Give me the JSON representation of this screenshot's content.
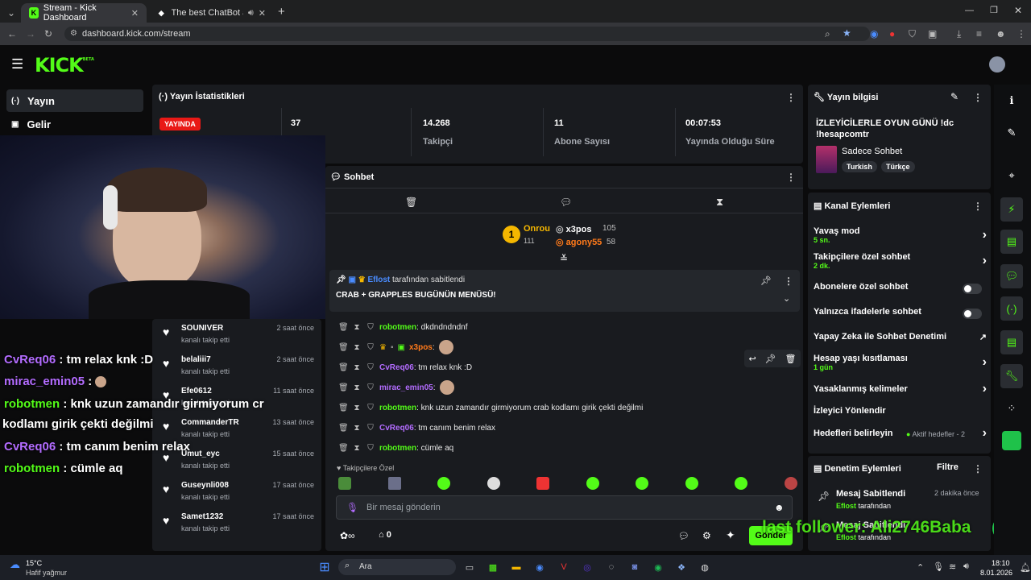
{
  "browser": {
    "tabs": [
      {
        "title": "Stream - Kick Dashboard",
        "icon": "kick-icon"
      },
      {
        "title": "The best ChatBot and Widg",
        "icon": "chatbot-icon"
      }
    ],
    "url": "dashboard.kick.com/stream"
  },
  "brand": {
    "logo": "KICK",
    "beta": "BETA",
    "accent": "#53fc18"
  },
  "sidebar": {
    "items": [
      {
        "label": "Yayın",
        "icon": "broadcast-icon"
      },
      {
        "label": "Gelir",
        "icon": "revenue-icon"
      }
    ]
  },
  "stats": {
    "title": "Yayın İstatistikleri",
    "live_badge": "YAYINDA",
    "viewers": "37",
    "followers": {
      "value": "14.268",
      "label": "Takipçi"
    },
    "subs": {
      "value": "11",
      "label": "Abone Sayısı"
    },
    "duration": {
      "value": "00:07:53",
      "label": "Yayında Olduğu Süre"
    }
  },
  "overlay_chat": [
    {
      "user": "CvReq06",
      "text": " : tm relax knk :D",
      "color": "#b36cff"
    },
    {
      "user": "mirac_emin05",
      "text": " :",
      "color": "#b36cff"
    },
    {
      "user": "robotmen",
      "text": " : knk uzun zamandır girmiyorum cr",
      "color": "#53fc18"
    },
    {
      "user": "",
      "text": "kodlamı girik çekti değilmi",
      "color": "#fff"
    },
    {
      "user": "CvReq06",
      "text": " : tm canım benim relax",
      "color": "#b36cff"
    },
    {
      "user": "robotmen",
      "text": " : cümle aq",
      "color": "#53fc18"
    }
  ],
  "followers_list": [
    {
      "name": "SOUNIVER",
      "sub": "kanalı takip etti",
      "time": "2 saat önce"
    },
    {
      "name": "belaliii7",
      "sub": "kanalı takip etti",
      "time": "2 saat önce"
    },
    {
      "name": "Efe0612",
      "sub": "kanalı takip etti",
      "time": "11 saat önce"
    },
    {
      "name": "CommanderTR",
      "sub": "kanalı takip etti",
      "time": "13 saat önce"
    },
    {
      "name": "Umut_eyc",
      "sub": "kanalı takip etti",
      "time": "15 saat önce"
    },
    {
      "name": "Guseynli008",
      "sub": "kanalı takip etti",
      "time": "17 saat önce"
    },
    {
      "name": "Samet1232",
      "sub": "kanalı takip etti",
      "time": "17 saat önce"
    }
  ],
  "chat": {
    "title": "Sohbet",
    "leaderboard": {
      "top": {
        "name": "Onrou",
        "count": "111"
      },
      "second": {
        "name": "x3pos",
        "count": "105"
      },
      "third": {
        "name": "agony55",
        "count": "58"
      },
      "rank": "1"
    },
    "pinned": {
      "by_user": "Eflost",
      "by_text": "tarafından sabitlendi",
      "message": "CRAB + GRAPPLES BUGÜNÜN MENÜSÜ!"
    },
    "messages": [
      {
        "user": "robotmen",
        "text": "dkdndndndnf",
        "color": "#53fc18"
      },
      {
        "user": "x3pos",
        "text": "",
        "color": "#ff7a1a"
      },
      {
        "user": "CvReq06",
        "text": "tm relax knk :D",
        "color": "#b36cff"
      },
      {
        "user": "mirac_emin05",
        "text": "",
        "color": "#b36cff"
      },
      {
        "user": "robotmen",
        "text": "knk uzun zamandır girmiyorum crab kodlamı girik çekti değilmi",
        "color": "#53fc18"
      },
      {
        "user": "CvReq06",
        "text": "tm canım benim relax",
        "color": "#b36cff"
      },
      {
        "user": "robotmen",
        "text": "cümle aq",
        "color": "#53fc18"
      }
    ],
    "followers_only": "Takipçilere Özel",
    "input_placeholder": "Bir mesaj gönderin",
    "points": "0",
    "send": "Gönder"
  },
  "stream_info": {
    "title": "Yayın bilgisi",
    "stream_title": "İZLEYİCİLERLE OYUN GÜNÜ !dc !hesapcomtr",
    "category": "Sadece Sohbet",
    "tags": [
      "Turkish",
      "Türkçe"
    ]
  },
  "channel_actions": {
    "title": "Kanal Eylemleri",
    "items": [
      {
        "label": "Yavaş mod",
        "sub": "5 sn.",
        "control": "chevron"
      },
      {
        "label": "Takipçilere özel sohbet",
        "sub": "2 dk.",
        "control": "chevron"
      },
      {
        "label": "Abonelere özel sohbet",
        "sub": "",
        "control": "toggle"
      },
      {
        "label": "Yalnızca ifadelerle sohbet",
        "sub": "",
        "control": "toggle"
      },
      {
        "label": "Yapay Zeka ile Sohbet Denetimi",
        "sub": "",
        "control": "external"
      },
      {
        "label": "Hesap yaşı kısıtlaması",
        "sub": "1 gün",
        "control": "chevron"
      },
      {
        "label": "Yasaklanmış kelimeler",
        "sub": "",
        "control": "chevron"
      },
      {
        "label": "İzleyici Yönlendir",
        "sub": "",
        "control": "none"
      },
      {
        "label": "Hedefleri belirleyin",
        "sub": "",
        "control": "chevron"
      }
    ],
    "goals_status": "Aktif hedefler - 2"
  },
  "moderation": {
    "title": "Denetim Eylemleri",
    "filter": "Filtre",
    "items": [
      {
        "label": "Mesaj Sabitlendi",
        "user": "Eflost",
        "by": "tarafından",
        "time": "2 dakika önce"
      },
      {
        "label": "Mesaj Sabitlendi",
        "user": "Eflost",
        "by": "tarafından",
        "time": ""
      }
    ]
  },
  "overlay_banner": "last follower: Ali2746Baba",
  "taskbar": {
    "temp": "15°C",
    "weather": "Hafif yağmur",
    "search": "Ara",
    "time": "18:10",
    "date": "8.01.2026"
  }
}
